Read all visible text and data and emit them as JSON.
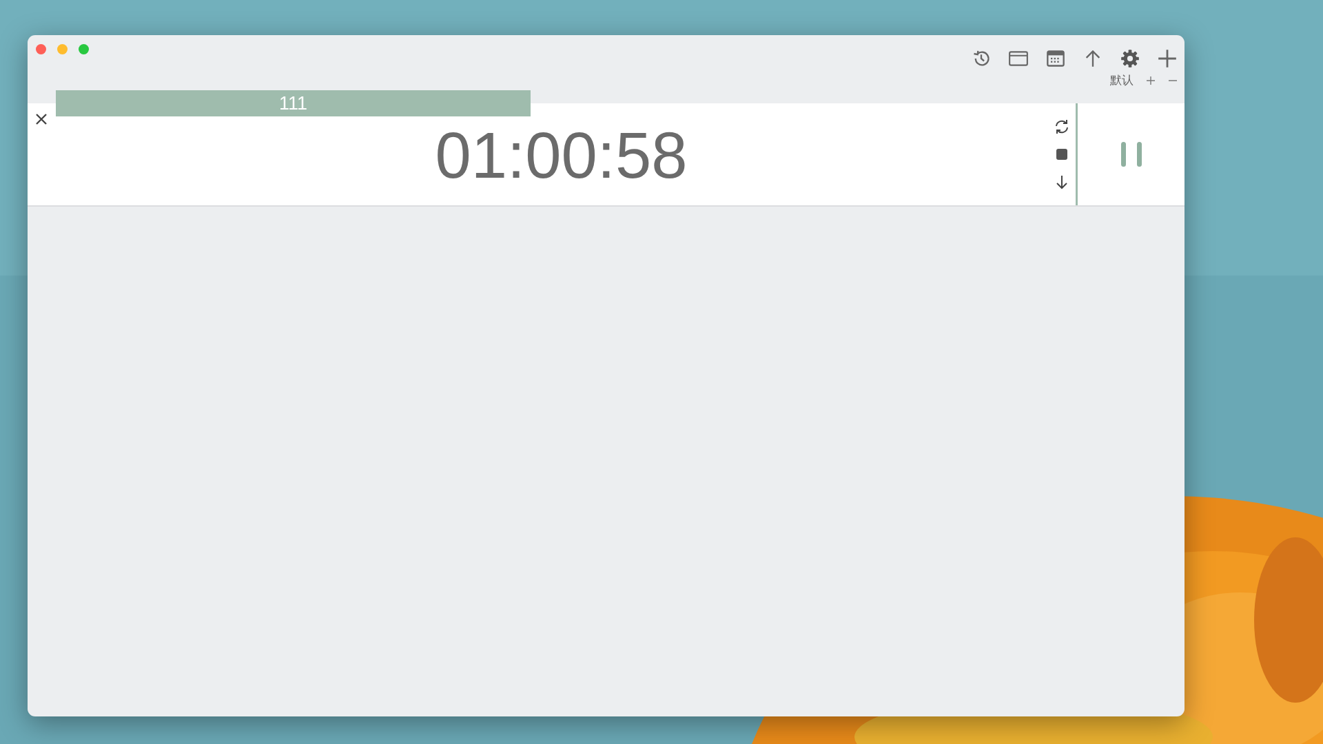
{
  "profile": {
    "name": "默认"
  },
  "task": {
    "label": "111"
  },
  "timer": {
    "time": "01:00:58",
    "running": true
  }
}
